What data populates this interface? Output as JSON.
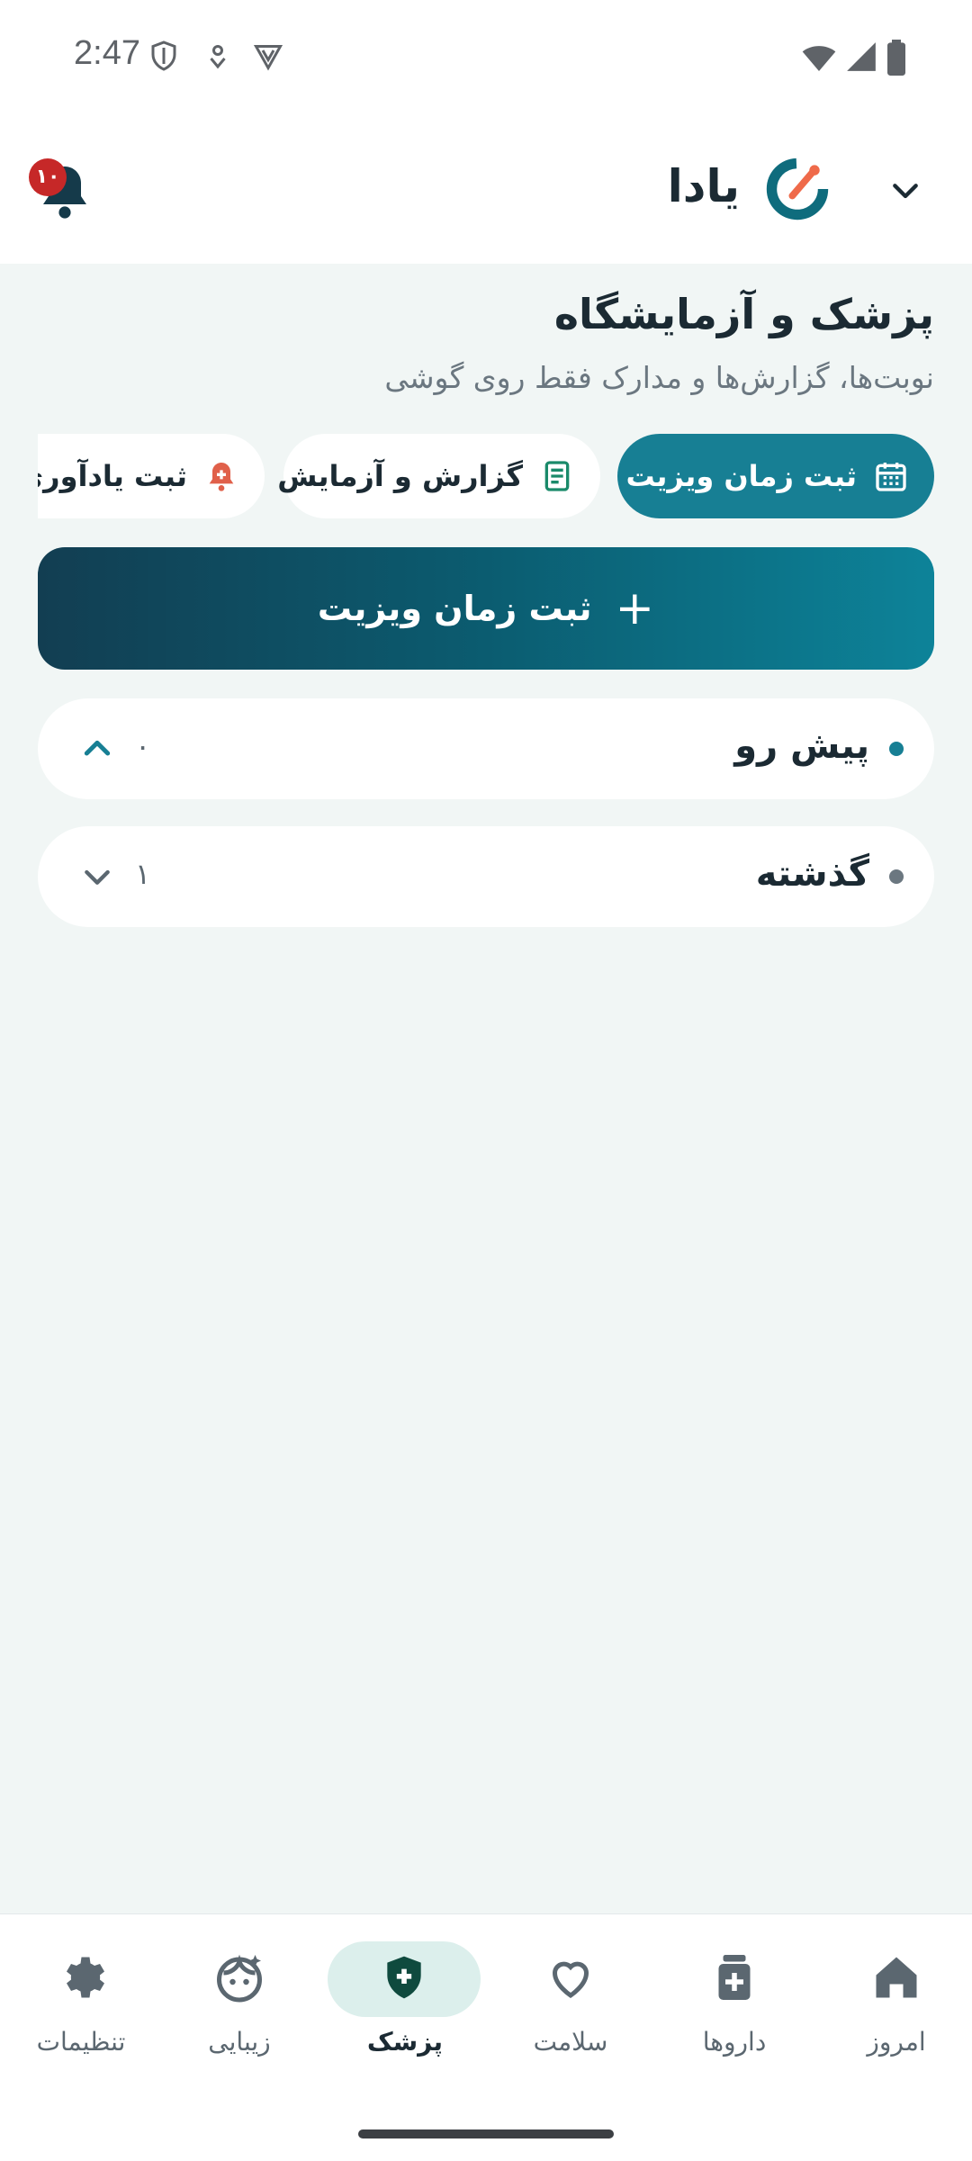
{
  "status_bar": {
    "time": "2:47"
  },
  "header": {
    "app_name": "یادا",
    "notification_count": "۱۰"
  },
  "page": {
    "title": "پزشک و آزمایشگاه",
    "subtitle": "نوبت‌ها، گزارش‌ها و مدارک فقط روی گوشی"
  },
  "chips": [
    {
      "label": "ثبت زمان ویزیت",
      "icon": "calendar-icon",
      "active": true
    },
    {
      "label": "گزارش و آزمایش",
      "icon": "report-icon",
      "active": false
    },
    {
      "label": "ثبت یادآوری",
      "icon": "alarm-icon",
      "active": false
    }
  ],
  "cta": {
    "label": "ثبت زمان ویزیت"
  },
  "sections": [
    {
      "label": "پیش رو",
      "count": "۰",
      "expanded": true,
      "dot_color": "#177f94"
    },
    {
      "label": "گذشته",
      "count": "۱",
      "expanded": false,
      "dot_color": "#6b7780"
    }
  ],
  "bottom_nav": [
    {
      "label": "تنظیمات",
      "icon": "gear-icon"
    },
    {
      "label": "زیبایی",
      "icon": "face-icon"
    },
    {
      "label": "پزشک",
      "icon": "shield-plus-icon",
      "active": true
    },
    {
      "label": "سلامت",
      "icon": "heart-icon"
    },
    {
      "label": "داروها",
      "icon": "medicine-icon"
    },
    {
      "label": "امروز",
      "icon": "home-icon"
    }
  ],
  "colors": {
    "accent": "#177f94",
    "background": "#f1f6f5",
    "badge": "#c62828"
  }
}
